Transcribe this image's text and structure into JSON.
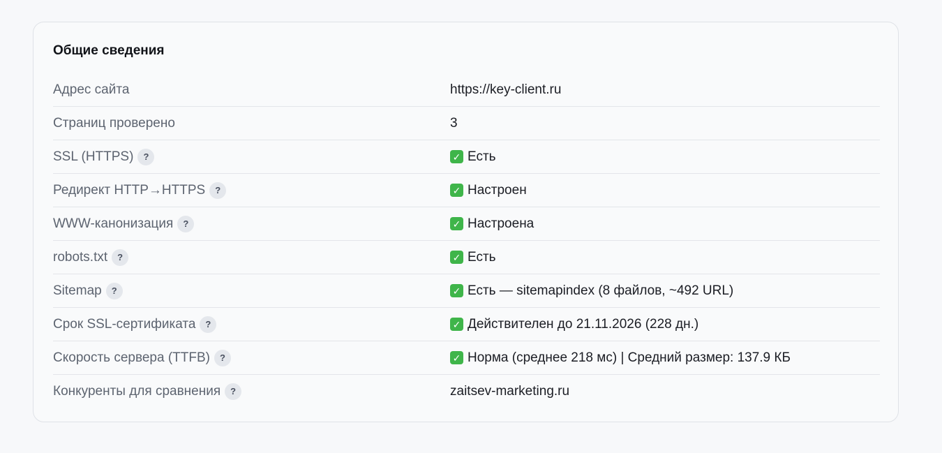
{
  "card": {
    "title": "Общие сведения"
  },
  "rows": [
    {
      "label": "Адрес сайта",
      "help": false,
      "check": false,
      "value": "https://key-client.ru"
    },
    {
      "label": "Страниц проверено",
      "help": false,
      "check": false,
      "value": "3"
    },
    {
      "label": "SSL (HTTPS)",
      "help": true,
      "check": true,
      "value": "Есть"
    },
    {
      "label": "Редирект HTTP→HTTPS",
      "help": true,
      "check": true,
      "value": "Настроен"
    },
    {
      "label": "WWW-канонизация",
      "help": true,
      "check": true,
      "value": "Настроена"
    },
    {
      "label": "robots.txt",
      "help": true,
      "check": true,
      "value": "Есть"
    },
    {
      "label": "Sitemap",
      "help": true,
      "check": true,
      "value": "Есть — sitemapindex (8 файлов, ~492 URL)"
    },
    {
      "label": "Срок SSL-сертификата",
      "help": true,
      "check": true,
      "value": "Действителен до 21.11.2026 (228 дн.)"
    },
    {
      "label": "Скорость сервера (TTFB)",
      "help": true,
      "check": true,
      "value": "Норма (среднее 218 мс) | Средний размер: 137.9 КБ"
    },
    {
      "label": "Конкуренты для сравнения",
      "help": true,
      "check": false,
      "value": "zaitsev-marketing.ru"
    }
  ],
  "icons": {
    "help_glyph": "?",
    "check_glyph": "✓",
    "check_color": "#3fb54a"
  }
}
